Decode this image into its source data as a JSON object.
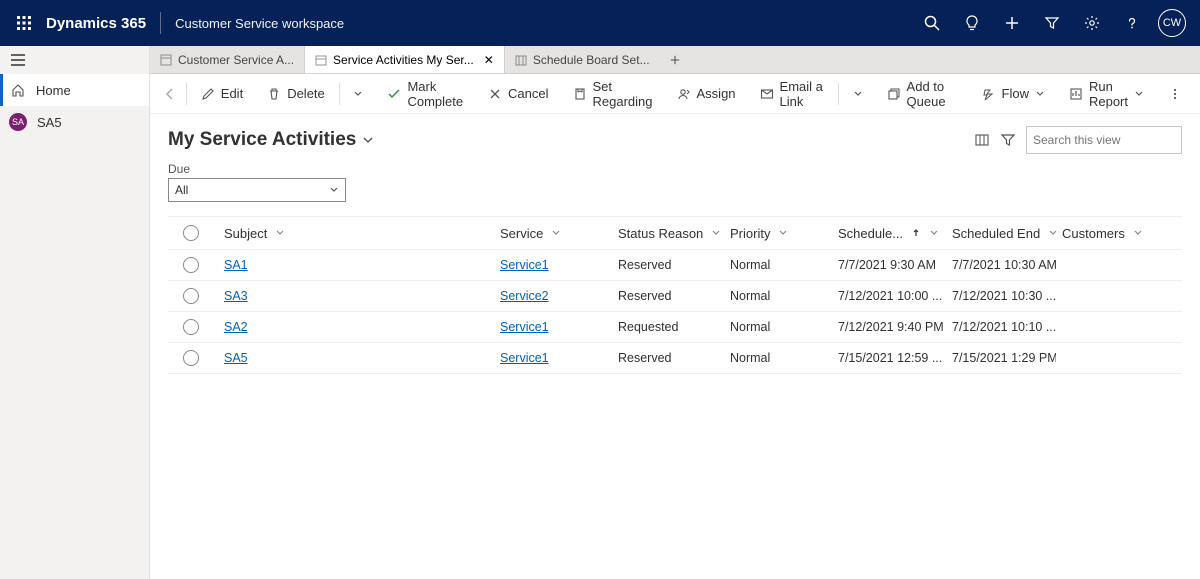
{
  "topbar": {
    "brand": "Dynamics 365",
    "workspace": "Customer Service workspace",
    "avatar": "CW"
  },
  "leftnav": {
    "home": "Home",
    "sa5": "SA5"
  },
  "tabs": [
    {
      "label": "Customer Service A..."
    },
    {
      "label": "Service Activities My Ser..."
    },
    {
      "label": "Schedule Board Set..."
    }
  ],
  "commands": {
    "edit": "Edit",
    "delete": "Delete",
    "markcomplete": "Mark Complete",
    "cancel": "Cancel",
    "setregarding": "Set Regarding",
    "assign": "Assign",
    "emaillink": "Email a Link",
    "addqueue": "Add to Queue",
    "flow": "Flow",
    "runreport": "Run Report"
  },
  "view": {
    "title": "My Service Activities",
    "due_label": "Due",
    "due_value": "All",
    "search_placeholder": "Search this view"
  },
  "columns": {
    "subject": "Subject",
    "service": "Service",
    "status": "Status Reason",
    "priority": "Priority",
    "start": "Schedule...",
    "end": "Scheduled End",
    "customers": "Customers"
  },
  "rows": [
    {
      "subject": "SA1",
      "service": "Service1",
      "status": "Reserved",
      "priority": "Normal",
      "start": "7/7/2021 9:30 AM",
      "end": "7/7/2021 10:30 AM",
      "customers": ""
    },
    {
      "subject": "SA3",
      "service": "Service2",
      "status": "Reserved",
      "priority": "Normal",
      "start": "7/12/2021 10:00 ...",
      "end": "7/12/2021 10:30 ...",
      "customers": ""
    },
    {
      "subject": "SA2",
      "service": "Service1",
      "status": "Requested",
      "priority": "Normal",
      "start": "7/12/2021 9:40 PM",
      "end": "7/12/2021 10:10 ...",
      "customers": ""
    },
    {
      "subject": "SA5",
      "service": "Service1",
      "status": "Reserved",
      "priority": "Normal",
      "start": "7/15/2021 12:59 ...",
      "end": "7/15/2021 1:29 PM",
      "customers": ""
    }
  ]
}
